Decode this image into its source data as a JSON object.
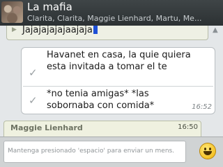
{
  "header": {
    "title": "La mafia",
    "members": "Clarita, Clarita, Maggie Lienhard, Martu, Me..."
  },
  "draft": {
    "text": "Jajajajajajaajaja"
  },
  "messages": [
    {
      "text": "Havanet en casa, la quie quiera esta invitada a tomar el te"
    },
    {
      "text": "*no tenia amigas* *las sobornaba con comida*",
      "time": "16:52"
    }
  ],
  "incoming": {
    "sender": "Maggie Lienhard",
    "time": "16:50",
    "text": "· · · · · ·"
  },
  "footer": {
    "placeholder": "Mantenga presionado 'espacio' para enviar un mens."
  },
  "colors": {
    "header": "#2f3436",
    "accent_caret": "#1d4fd6",
    "incoming_bubble": "#eff1e0"
  },
  "icons": [
    "group-avatar",
    "check-icon",
    "emoji-icon",
    "scroll-up-icon"
  ]
}
